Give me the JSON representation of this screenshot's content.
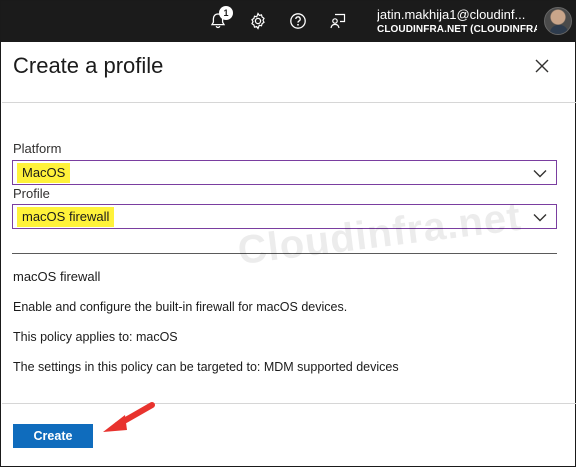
{
  "topbar": {
    "notification_count": "1",
    "account_name": "jatin.makhija1@cloudinf...",
    "account_tenant": "CLOUDINFRA.NET (CLOUDINFRA...",
    "icons": [
      "bell-icon",
      "gear-icon",
      "help-icon",
      "feedback-icon"
    ]
  },
  "panel": {
    "title": "Create a profile",
    "close_icon": "close-icon"
  },
  "form": {
    "platform_label": "Platform",
    "platform_value": "MacOS",
    "profile_label": "Profile",
    "profile_value": "macOS firewall"
  },
  "watermark": "Cloudinfra.net",
  "description": {
    "title": "macOS firewall",
    "summary": "Enable and configure the built-in firewall for macOS devices.",
    "applies_to": "This policy applies to: macOS",
    "targeted_to": "The settings in this policy can be targeted to: MDM supported devices"
  },
  "footer": {
    "create_label": "Create"
  },
  "colors": {
    "topbar_bg": "#1b1b1b",
    "highlight": "#fff23a",
    "select_border": "#7a3ea0",
    "primary_button": "#0f6cbd",
    "annotation_arrow": "#e8332e"
  }
}
